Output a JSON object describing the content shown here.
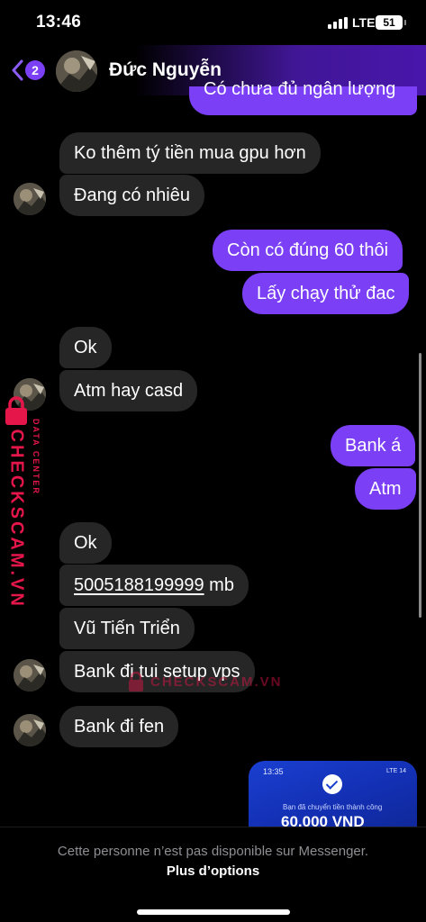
{
  "status_bar": {
    "time": "13:46",
    "network": "LTE",
    "battery": "51"
  },
  "header": {
    "back_badge": "2",
    "contact_name": "Đức Nguyễn"
  },
  "messages": [
    {
      "side": "out",
      "text": "Có chưa đủ ngân lượng"
    },
    {
      "side": "in",
      "text": "Ko thêm tý tiền mua gpu hơn"
    },
    {
      "side": "in",
      "text": "Đang có nhiêu"
    },
    {
      "side": "out",
      "text": "Còn có đúng 60 thôi"
    },
    {
      "side": "out",
      "text": "Lấy chạy thử đac"
    },
    {
      "side": "in",
      "text": "Ok"
    },
    {
      "side": "in",
      "text": "Atm hay casd"
    },
    {
      "side": "out",
      "text": "Bank á"
    },
    {
      "side": "out",
      "text": "Atm"
    },
    {
      "side": "in",
      "text": "Ok"
    },
    {
      "side": "in",
      "account": "5005188199999",
      "suffix": " mb"
    },
    {
      "side": "in",
      "text": "Vũ Tiến Triển"
    },
    {
      "side": "in",
      "text": "Bank đi tui setup vps"
    },
    {
      "side": "in",
      "text": "Bank đi fen"
    }
  ],
  "image_message": {
    "time": "13:35",
    "status": "LTE 14",
    "caption": "Bạn đã chuyển tiền thành công",
    "amount": "60.000 VND"
  },
  "watermark": {
    "brand": "CHECKSCAM.VN",
    "subtitle": "DATA CENTER"
  },
  "footer": {
    "unavailable_text": "Cette personne n’est pas disponible sur Messenger.",
    "more_options": "Plus d’options"
  },
  "colors": {
    "outgoing": "#7b3ff5",
    "incoming": "#262626",
    "watermark": "#e4164a"
  },
  "icons": {
    "back": "chevron-left-icon",
    "avatar": "contact-avatar",
    "watermark": "lock-icon"
  }
}
